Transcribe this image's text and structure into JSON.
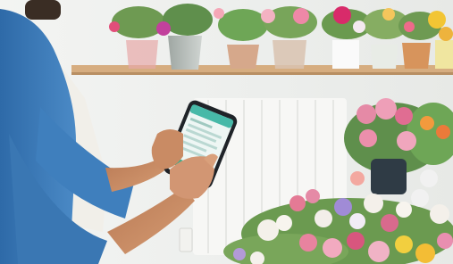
{
  "scene": {
    "description_labels": []
  },
  "phone_ui": {
    "header_color": "#47b9a8",
    "accent_color": "#2fae8d",
    "screen_bg": "#eef6f4"
  },
  "palette": {
    "wall": "#eef0ee",
    "shelf": "#d9b489",
    "radiator": "#f7f7f5",
    "shirt": "#3f7fbd",
    "skin": "#c98b64",
    "apron": "#f1efe9",
    "pink": "#e58aa6",
    "white_flower": "#f7f3ee",
    "green": "#5f8f4c"
  },
  "icons": [
    "flower-icon"
  ]
}
